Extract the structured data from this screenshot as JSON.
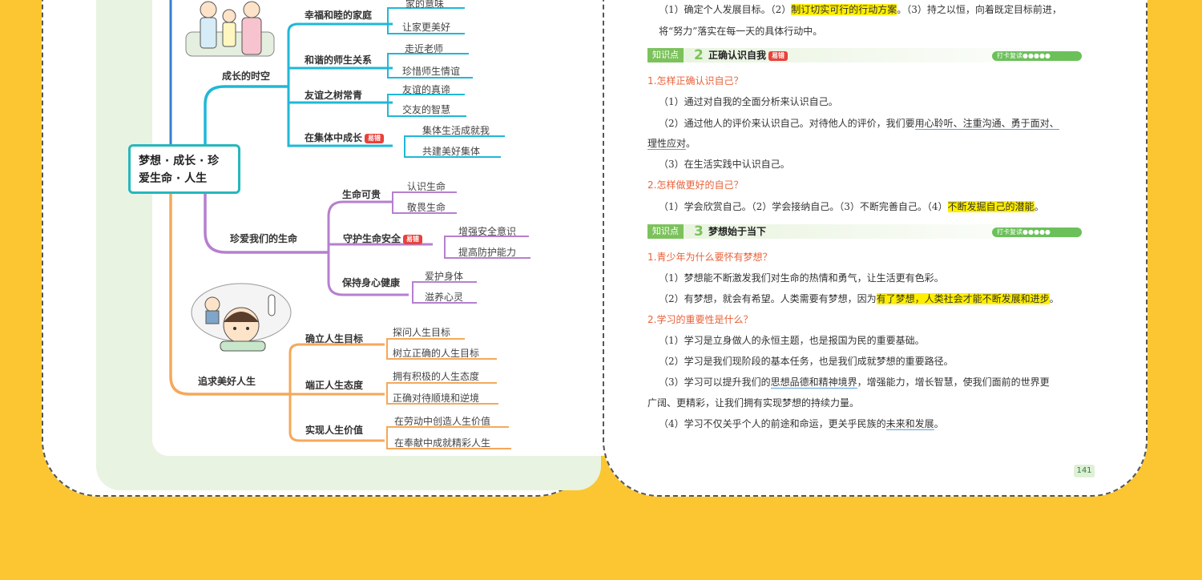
{
  "left_page": {
    "root": {
      "line1": "梦想 · 成长 · 珍",
      "line2": "爱生命 · 人生"
    },
    "badge": "易错",
    "groups": [
      {
        "label": "成长的时空",
        "subs": [
          {
            "label": "幸福和睦的家庭",
            "leaves": [
              "家的意味",
              "让家更美好"
            ]
          },
          {
            "label": "和谐的师生关系",
            "leaves": [
              "走近老师",
              "珍惜师生情谊"
            ]
          },
          {
            "label": "友谊之树常青",
            "leaves": [
              "友谊的真谛",
              "交友的智慧"
            ]
          },
          {
            "label": "在集体中成长",
            "leaves": [
              "集体生活成就我",
              "共建美好集体"
            ]
          }
        ]
      },
      {
        "label": "珍爱我们的生命",
        "subs": [
          {
            "label": "生命可贵",
            "leaves": [
              "认识生命",
              "敬畏生命"
            ]
          },
          {
            "label": "守护生命安全",
            "leaves": [
              "增强安全意识",
              "提高防护能力"
            ]
          },
          {
            "label": "保持身心健康",
            "leaves": [
              "爱护身体",
              "滋养心灵"
            ]
          }
        ]
      },
      {
        "label": "追求美好人生",
        "subs": [
          {
            "label": "确立人生目标",
            "leaves": [
              "探问人生目标",
              "树立正确的人生目标"
            ]
          },
          {
            "label": "端正人生态度",
            "leaves": [
              "拥有积极的人生态度",
              "正确对待顺境和逆境"
            ]
          },
          {
            "label": "实现人生价值",
            "leaves": [
              "在劳动中创造人生价值",
              "在奉献中成就精彩人生"
            ]
          }
        ]
      }
    ]
  },
  "right_page": {
    "top": {
      "a": "（1）确定个人发展目标。（2）",
      "hl": "制订切实可行的行动方案",
      "b": "。（3）持之以恒，向着既定目标前进，",
      "line2": "将“努力”落实在每一天的具体行动中。"
    },
    "kp2": {
      "tag": "知识点",
      "num": "2",
      "title": "正确认识自我",
      "badge": "易错",
      "pill": "打卡复读●●●●●"
    },
    "q1": "1.怎样正确认识自己？",
    "q1a1": "（1）通过对自我的全面分析来认识自己。",
    "q1a2a": "（2）通过他人的评价来认识自己。对待他人的评价，我们要",
    "q1a2u": "用心聆听、注重沟通、勇于面对、",
    "q1a2l2": "理性应对",
    "q1a2end": "。",
    "q1a3": "（3）在生活实践中认识自己。",
    "q2": "2.怎样做更好的自己？",
    "q2a": "（1）学会欣赏自己。（2）学会接纳自己。（3）不断完善自己。（4）",
    "q2hl": "不断发掘自己的潜能",
    "q2end": "。",
    "kp3": {
      "tag": "知识点",
      "num": "3",
      "title": "梦想始于当下",
      "pill": "打卡复读●●●●●"
    },
    "q3": "1.青少年为什么要怀有梦想？",
    "q3a1": "（1）梦想能不断激发我们对生命的热情和勇气，让生活更有色彩。",
    "q3a2a": "（2）有梦想，就会有希望。人类需要有梦想，因为",
    "q3a2hl": "有了梦想，人类社会才能不断发展和进步",
    "q3a2end": "。",
    "q4": "2.学习的重要性是什么？",
    "q4a1": "（1）学习是立身做人的永恒主题，也是报国为民的重要基础。",
    "q4a2": "（2）学习是我们现阶段的基本任务，也是我们成就梦想的重要路径。",
    "q4a3a": "（3）学习可以提升我们的",
    "q4a3u": "思想品德和精神境界",
    "q4a3b": "，增强能力，增长智慧，使我们面前的世界更",
    "q4a3l2": "广阔、更精彩，让我们拥有实现梦想的持续力量。",
    "q4a4a": "（4）学习不仅关乎个人的前途和命运，更关乎民族的",
    "q4a4u": "未来和发展",
    "q4a4end": "。",
    "page_number": "141"
  }
}
